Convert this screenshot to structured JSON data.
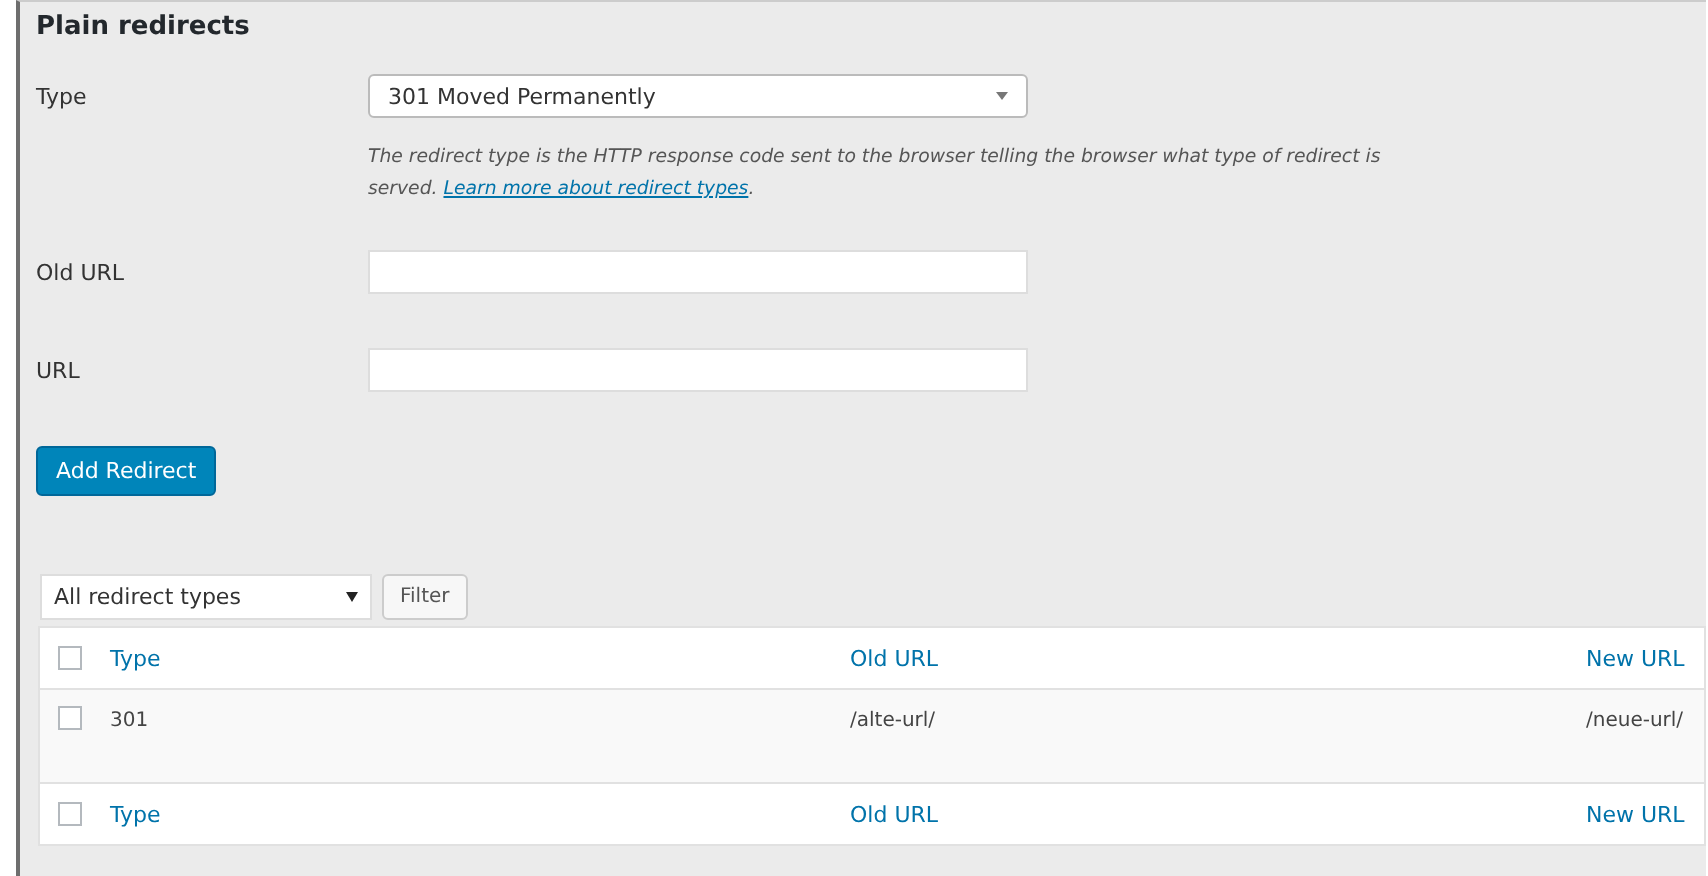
{
  "section_title": "Plain redirects",
  "form": {
    "type_label": "Type",
    "type_value": "301 Moved Permanently",
    "help_text": "The redirect type is the HTTP response code sent to the browser telling the browser what type of redirect is served.",
    "help_link": "Learn more about redirect types",
    "help_end": ".",
    "old_url_label": "Old URL",
    "url_label": "URL",
    "submit": "Add Redirect"
  },
  "filter": {
    "select_value": "All redirect types",
    "button": "Filter"
  },
  "table": {
    "header": {
      "checked": false,
      "columns": [
        "Type",
        "Old URL",
        "New URL"
      ]
    },
    "rows": [
      {
        "checked": false,
        "type": "301",
        "old_url": "/alte-url/",
        "new_url": "/neue-url/"
      }
    ],
    "footer": {
      "checked": false,
      "columns": [
        "Type",
        "Old URL",
        "New URL"
      ]
    }
  }
}
